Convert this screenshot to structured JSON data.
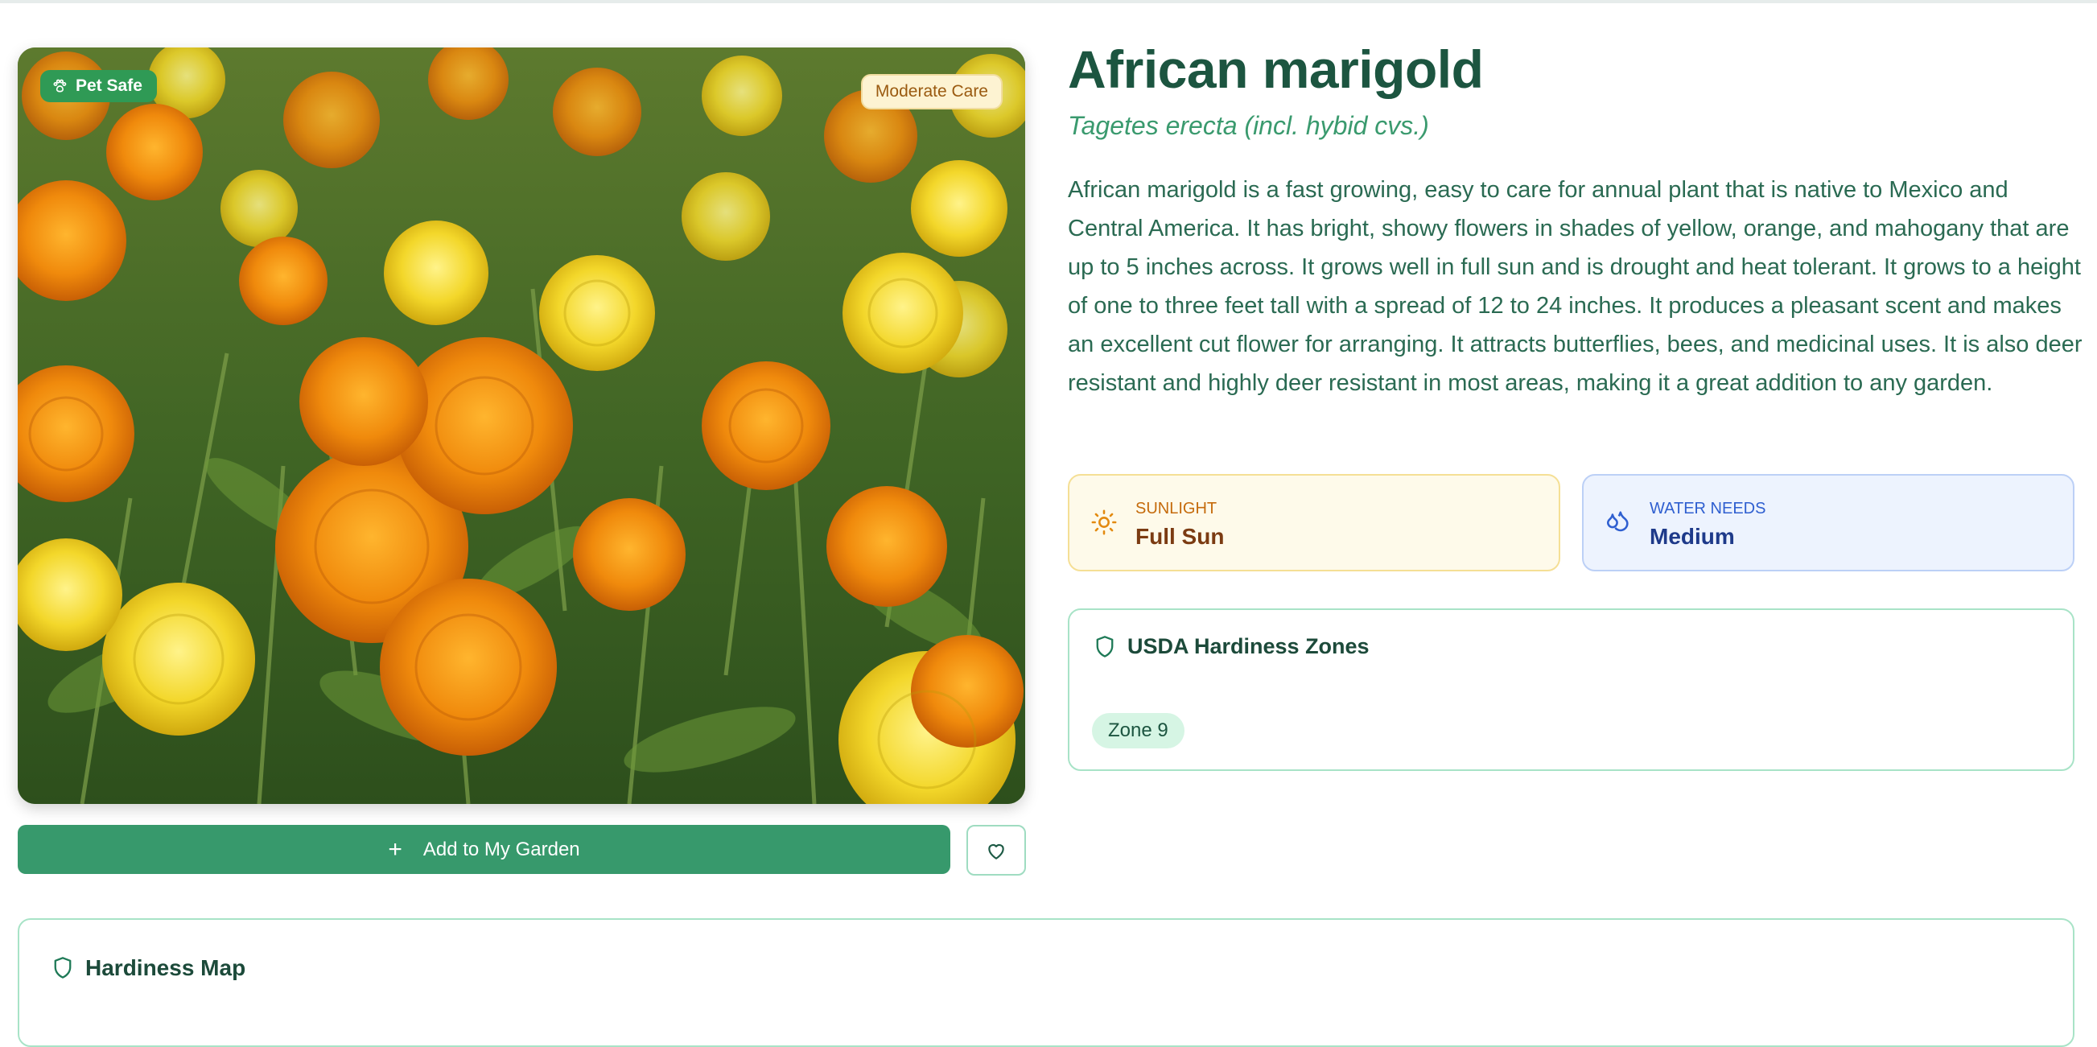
{
  "plant": {
    "common_name": "African marigold",
    "scientific_name": "Tagetes erecta (incl. hybid cvs.)",
    "description": "African marigold is a fast growing, easy to care for annual plant that is native to Mexico and Central America. It has bright, showy flowers in shades of yellow, orange, and mahogany that are up to 5 inches across. It grows well in full sun and is drought and heat tolerant. It grows to a height of one to three feet tall with a spread of 12 to 24 inches. It produces a pleasant scent and makes an excellent cut flower for arranging. It attracts butterflies, bees, and medicinal uses. It is also deer resistant and highly deer resistant in most areas, making it a great addition to any garden."
  },
  "badges": {
    "pet_safe": "Pet Safe",
    "care_level": "Moderate Care"
  },
  "actions": {
    "add_to_garden": "Add to My Garden"
  },
  "stats": {
    "sunlight": {
      "label": "SUNLIGHT",
      "value": "Full Sun"
    },
    "water": {
      "label": "WATER NEEDS",
      "value": "Medium"
    }
  },
  "hardiness": {
    "title": "USDA Hardiness Zones",
    "zones": [
      "Zone 9"
    ]
  },
  "map": {
    "title": "Hardiness Map"
  },
  "icons": {
    "pet_safe": "paw-icon",
    "add": "plus-icon",
    "favorite": "heart-icon",
    "sunlight": "sun-icon",
    "water": "droplets-icon",
    "hardiness": "shield-icon"
  },
  "colors": {
    "primary": "#37996c",
    "heading": "#1c5540",
    "pet_badge": "#2f9a55",
    "sun_bg": "#fefaea",
    "water_bg": "#edf3fe",
    "zone_chip": "#d6f5e4"
  }
}
